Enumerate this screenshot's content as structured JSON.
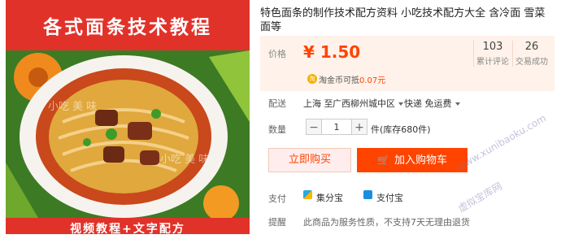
{
  "image": {
    "banner_title": "各式面条技术教程",
    "banner_subtitle": "视频教程+文字配方",
    "watermark": "小吃 美 味"
  },
  "product": {
    "title": "特色面条的制作技术配方资料 小吃技术配方大全 含冷面 雪菜面等"
  },
  "price": {
    "label": "价格",
    "value": "¥ 1.50",
    "reviews_count": "103",
    "reviews_label": "累计评论",
    "sales_count": "26",
    "sales_label": "交易成功"
  },
  "coins": {
    "icon_text": "淘",
    "text": "淘金币可抵",
    "amount": "0.07元"
  },
  "shipping": {
    "label": "配送",
    "origin": "上海 至",
    "destination": "广西柳州城中区",
    "method": "快递 免运费"
  },
  "quantity": {
    "label": "数量",
    "minus": "−",
    "value": "1",
    "plus": "+",
    "unit": "件(库存680件)"
  },
  "actions": {
    "buy_now": "立即购买",
    "add_to_cart": "加入购物车"
  },
  "payment": {
    "label": "支付",
    "option1": "集分宝",
    "option2": "支付宝"
  },
  "notice": {
    "label": "提醒",
    "text": "此商品为服务性质，不支持7天无理由退货"
  },
  "site_watermark": {
    "url": "www.xunibaoku.com",
    "name": "虚拟宝库网"
  },
  "colors": {
    "accent": "#ff4400",
    "banner_red": "#e1322a",
    "price_bg": "#fff2ea"
  }
}
